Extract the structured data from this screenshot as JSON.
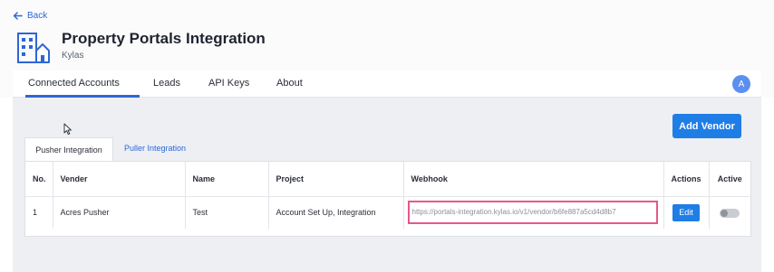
{
  "nav": {
    "back_label": "Back"
  },
  "header": {
    "title": "Property Portals Integration",
    "subtitle": "Kylas"
  },
  "tabs": [
    {
      "label": "Connected Accounts",
      "active": true
    },
    {
      "label": "Leads"
    },
    {
      "label": "API Keys"
    },
    {
      "label": "About"
    }
  ],
  "user": {
    "avatar_initial": "A"
  },
  "toolbar": {
    "add_vendor_label": "Add Vendor"
  },
  "integration_tabs": [
    {
      "label": "Pusher Integration",
      "active": true
    },
    {
      "label": "Puller Integration"
    }
  ],
  "table": {
    "columns": [
      "No.",
      "Vender",
      "Name",
      "Project",
      "Webhook",
      "Actions",
      "Active"
    ],
    "rows": [
      {
        "no": "1",
        "vender": "Acres Pusher",
        "name": "Test",
        "project": "Account Set Up, Integration",
        "webhook": "https://portals-integration.kylas.io/v1/vendor/b6fe887a5cd4d8b7",
        "action_label": "Edit",
        "active": false
      }
    ]
  },
  "colors": {
    "accent": "#1f7de6",
    "highlight": "#e8578a",
    "avatar": "#5b8ff0"
  }
}
